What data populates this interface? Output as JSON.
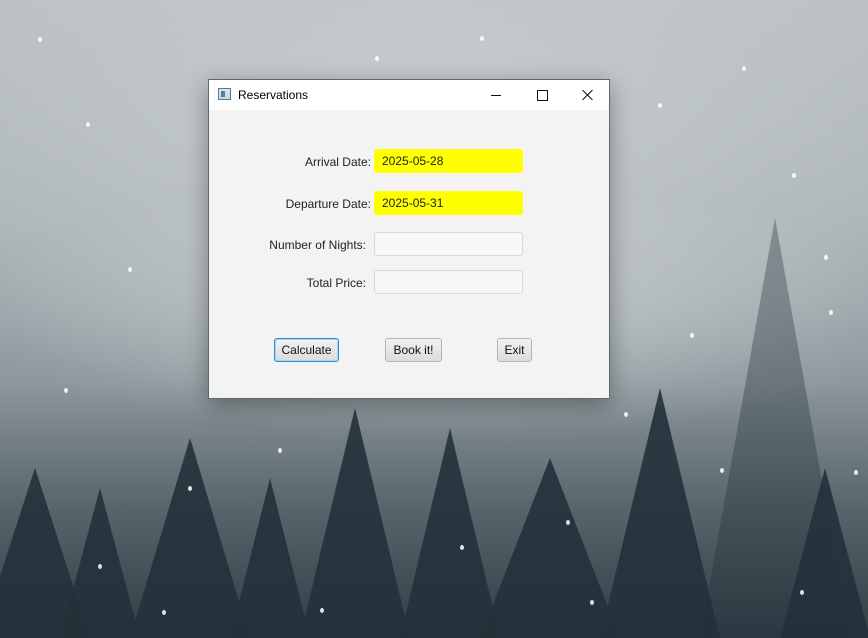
{
  "window": {
    "title": "Reservations",
    "icon": "app-window-icon"
  },
  "form": {
    "arrival_label": "Arrival Date:",
    "arrival_value": "2025-05-28",
    "departure_label": "Departure Date:",
    "departure_value": "2025-05-31",
    "nights_label": "Number of Nights:",
    "nights_value": "",
    "total_label": "Total Price:",
    "total_value": ""
  },
  "buttons": {
    "calculate": "Calculate",
    "book": "Book it!",
    "exit": "Exit"
  },
  "colors": {
    "highlight": "#ffff00",
    "focus": "#2a8ad4"
  }
}
